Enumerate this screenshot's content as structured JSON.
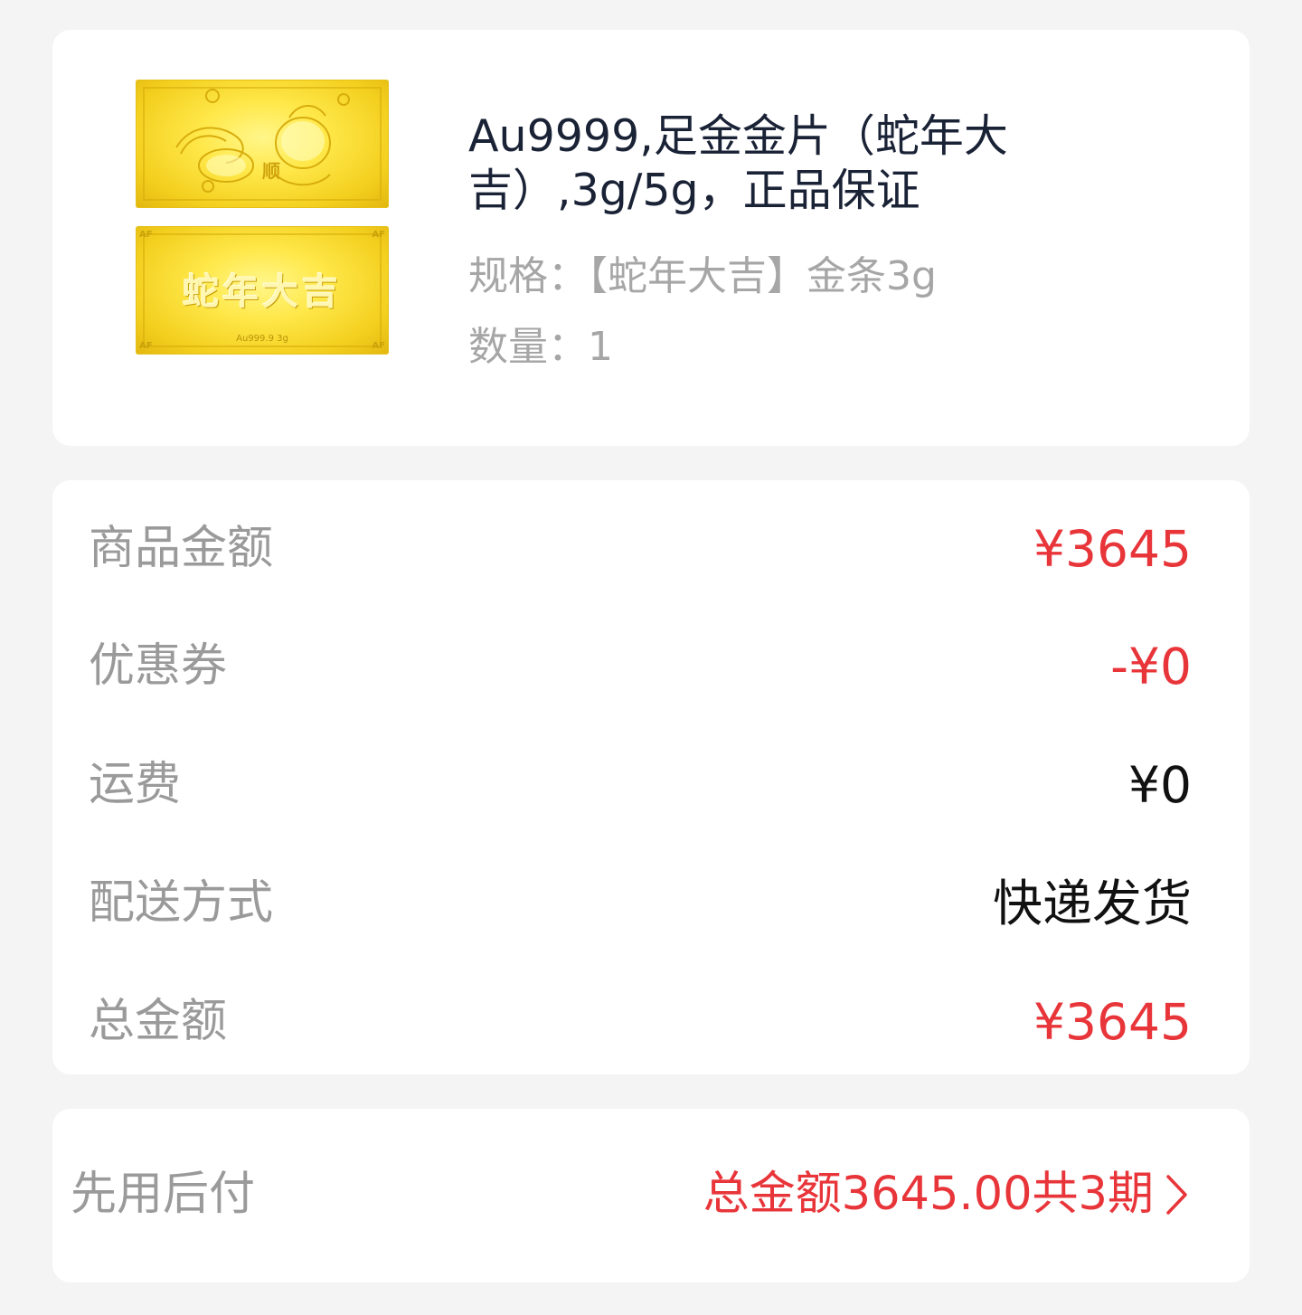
{
  "product": {
    "title": "Au9999,足金金片（蛇年大吉）,3g/5g，正品保证",
    "spec": "规格：【蛇年大吉】金条3g",
    "quantity": "数量：1",
    "image": {
      "back_text": "蛇年大吉",
      "back_fine_text": "Au999.9 3g",
      "corner_mark": "AF"
    }
  },
  "pricing": {
    "rows": [
      {
        "label": "商品金额",
        "value": "¥3645",
        "color": "#e8353a"
      },
      {
        "label": "优惠券",
        "value": "-¥0",
        "color": "#e8353a"
      },
      {
        "label": "运费",
        "value": "¥0",
        "color": "#111111"
      },
      {
        "label": "配送方式",
        "value": "快递发货",
        "color": "#111111"
      },
      {
        "label": "总金额",
        "value": "¥3645",
        "color": "#e8353a"
      }
    ]
  },
  "pay_later": {
    "label": "先用后付",
    "summary": "总金额3645.00共3期",
    "icon": "chevron-right-icon"
  },
  "colors": {
    "accent_red": "#e8353a",
    "label_gray": "#9a9a9a",
    "background": "#f4f4f4",
    "gold": "#ffe84a"
  }
}
